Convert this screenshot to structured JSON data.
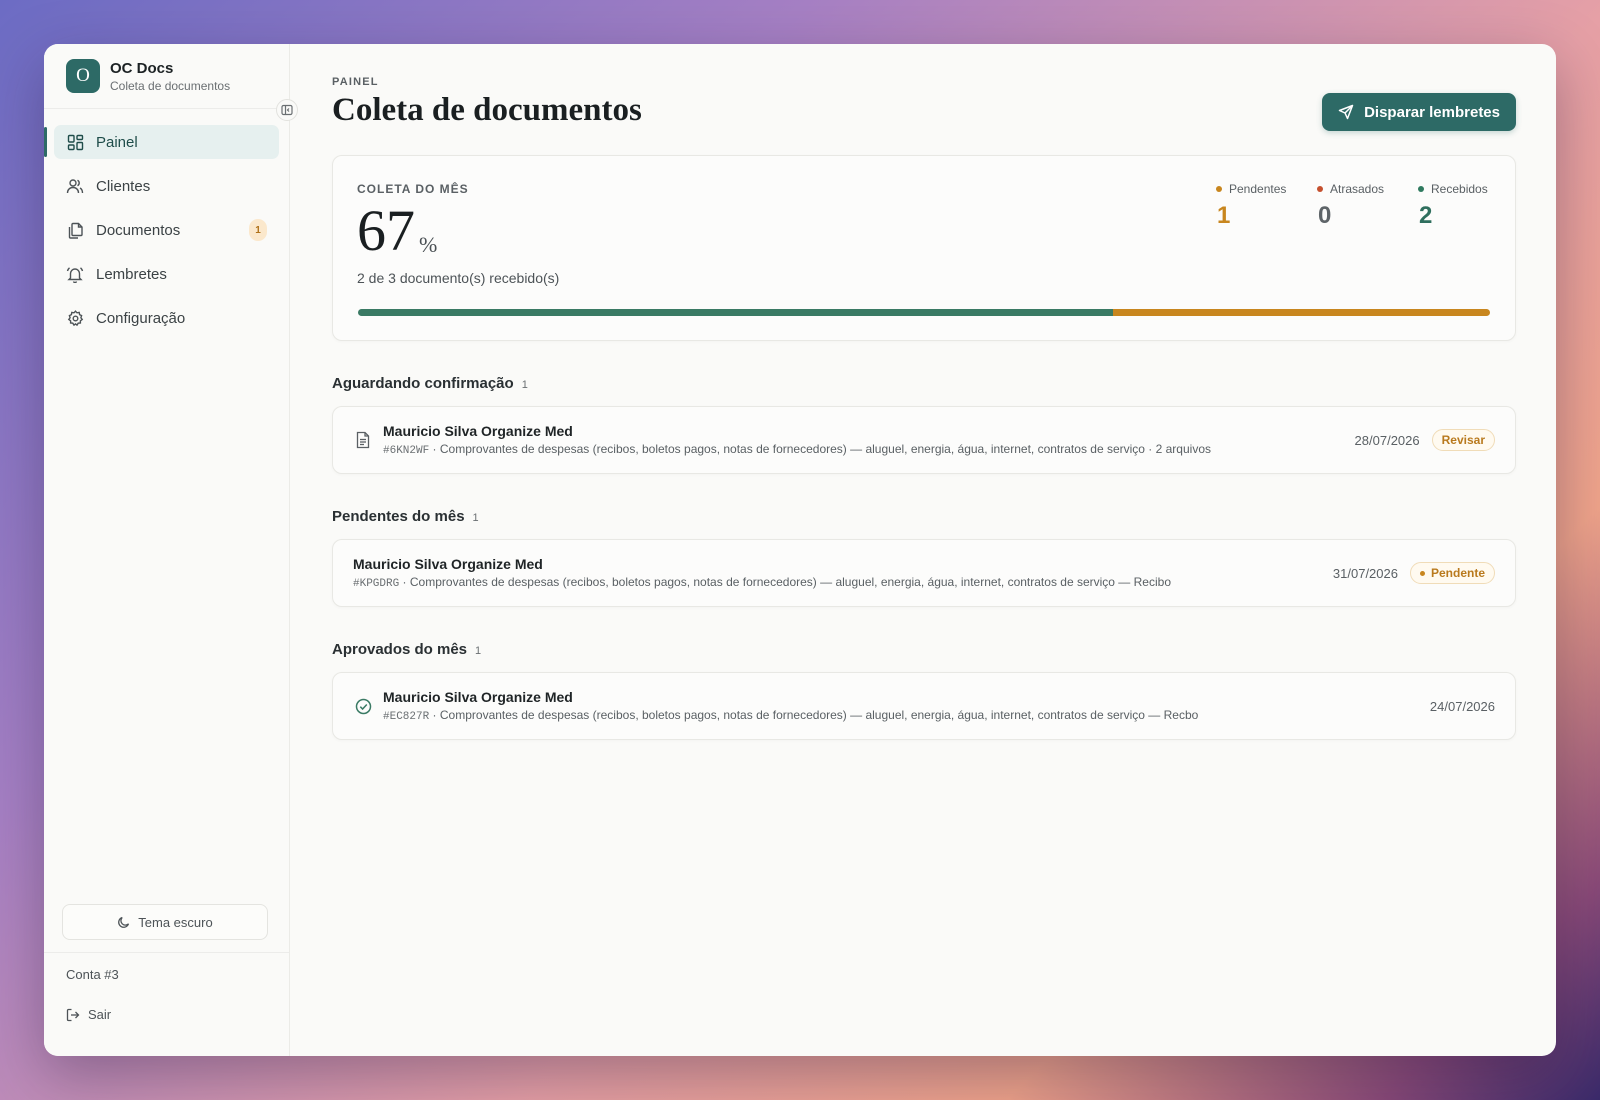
{
  "brand": {
    "logo_letter": "O",
    "name": "OC Docs",
    "subtitle": "Coleta de documentos"
  },
  "sidebar": {
    "items": [
      {
        "label": "Painel",
        "icon": "dashboard-icon",
        "active": true
      },
      {
        "label": "Clientes",
        "icon": "users-icon"
      },
      {
        "label": "Documentos",
        "icon": "documents-icon",
        "badge": "1"
      },
      {
        "label": "Lembretes",
        "icon": "bell-icon"
      },
      {
        "label": "Configuração",
        "icon": "gear-icon"
      }
    ],
    "theme_button": "Tema escuro",
    "account": "Conta #3",
    "logout": "Sair"
  },
  "header": {
    "eyebrow": "PAINEL",
    "title": "Coleta de documentos",
    "action_label": "Disparar lembretes"
  },
  "stats": {
    "label": "COLETA DO MÊS",
    "percent": "67",
    "unit": "%",
    "summary": "2 de 3 documento(s) recebido(s)",
    "progress_received_fraction": 0.667,
    "counters": [
      {
        "label": "Pendentes",
        "value": "1",
        "color": "#c8861e"
      },
      {
        "label": "Atrasados",
        "value": "0",
        "color": "#c5502e",
        "value_color": "#5e6468"
      },
      {
        "label": "Recebidos",
        "value": "2",
        "color": "#2f7a5f"
      }
    ]
  },
  "colors": {
    "accent": "#2d6a66",
    "received": "#3a7a64",
    "pending": "#c8861e"
  },
  "sections": {
    "awaiting": {
      "title": "Aguardando confirmação",
      "count": "1",
      "row": {
        "title": "Mauricio Silva Organize Med",
        "code": "#6KN2WF",
        "meta": " · Comprovantes de despesas (recibos, boletos pagos, notas de fornecedores) — aluguel, energia, água, internet, contratos de serviço · 2 arquivos",
        "date": "28/07/2026",
        "action": "Revisar"
      }
    },
    "pending": {
      "title": "Pendentes do mês",
      "count": "1",
      "row": {
        "title": "Mauricio Silva Organize Med",
        "code": "#KPGDRG",
        "meta": " · Comprovantes de despesas (recibos, boletos pagos, notas de fornecedores) — aluguel, energia, água, internet, contratos de serviço — Recibo",
        "date": "31/07/2026",
        "status": "Pendente"
      }
    },
    "approved": {
      "title": "Aprovados do mês",
      "count": "1",
      "row": {
        "title": "Mauricio Silva Organize Med",
        "code": "#EC827R",
        "meta": " · Comprovantes de despesas (recibos, boletos pagos, notas de fornecedores) — aluguel, energia, água, internet, contratos de serviço — Recbo",
        "date": "24/07/2026"
      }
    }
  }
}
